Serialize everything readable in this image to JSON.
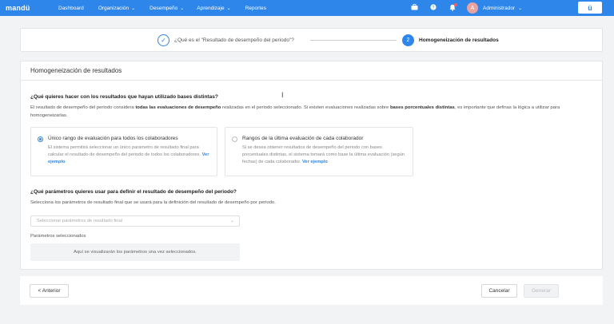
{
  "nav": {
    "brand": "mandü",
    "items": [
      {
        "label": "Dashboard",
        "has_dropdown": false
      },
      {
        "label": "Organización",
        "has_dropdown": true
      },
      {
        "label": "Desempeño",
        "has_dropdown": true
      },
      {
        "label": "Aprendizaje",
        "has_dropdown": true
      },
      {
        "label": "Reportes",
        "has_dropdown": false
      }
    ],
    "user_initial": "A",
    "user_name": "Administrador",
    "logo_text": "ü",
    "accent_color": "#2f86ea"
  },
  "stepper": {
    "step1_label": "¿Qué es el \"Resultado de desempeño del periodo\"?",
    "step2_number": "2",
    "step2_label": "Homogeneización de resultados"
  },
  "card": {
    "title": "Homogeneización de resultados",
    "question1": "¿Qué quieres hacer con los resultados que hayan utilizado bases distintas?",
    "desc1_a": "El resultado de desempeño del periodo considera ",
    "desc1_b": "todas las evaluaciones de desempeño",
    "desc1_c": " realizadas en el periodo seleccionado. Si existen evaluaciones realizadas sobre ",
    "desc1_d": "bases porcentuales distintas",
    "desc1_e": ", es importante que definas la lógica a utilizar para homogeneizarlas.",
    "option1": {
      "title": "Único rango de evaluación para todos los colaboradores",
      "desc": "El sistema permitirá seleccionar un único parámetro de resultado final para calcular el resultado de desempeño del periodo de todos los colaboradores.",
      "link": "Ver ejemplo",
      "selected": true
    },
    "option2": {
      "title": "Rangos de la última evaluación de cada colaborador",
      "desc": "Si se desea obtener resultados de desempeño del periodo con bases porcentuales distintas, el sistema tomará como base la última evaluación (según fechas) de cada colaborador.",
      "link": "Ver ejemplo",
      "selected": false
    },
    "question2": "¿Qué parámetros quieres usar para definir el resultado de desempeño del periodo?",
    "desc2": "Selecciona los parámetros de resultado final que se usará para la definición del resultado de desempeño por periodo.",
    "select_placeholder": "Seleccionar parámetros de resultado final",
    "params_label": "Parámetros seleccionados",
    "params_empty": "Aquí se visualizarán los parámetros una vez seleccionados."
  },
  "footer": {
    "back_label": "< Anterior",
    "cancel_label": "Cancelar",
    "generate_label": "Generar"
  }
}
